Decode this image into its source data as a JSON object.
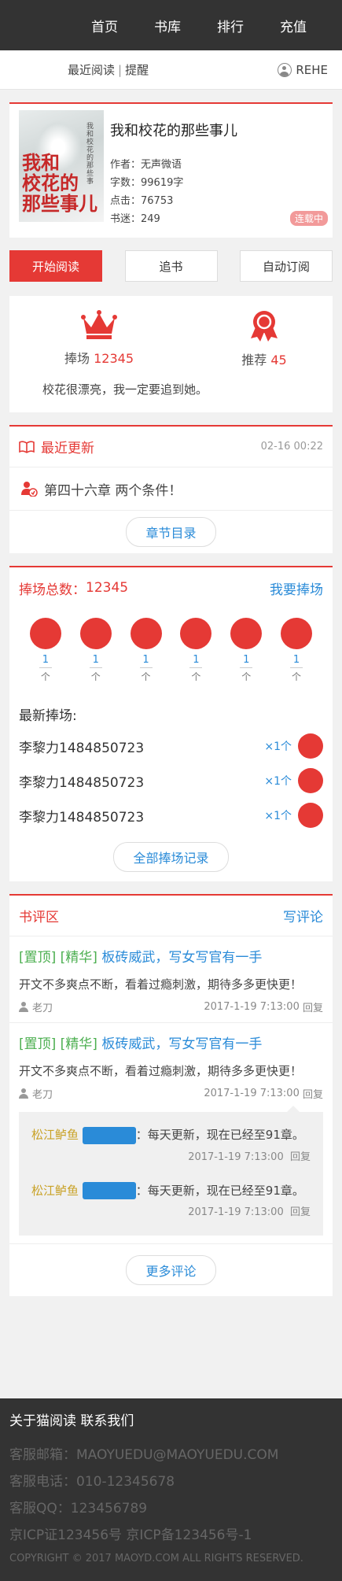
{
  "nav": {
    "items": [
      "首页",
      "书库",
      "排行",
      "充值"
    ]
  },
  "subbar": {
    "recent": "最近阅读",
    "sep": "|",
    "remind": "提醒",
    "user": "REHE"
  },
  "book": {
    "title": "我和校花的那些事儿",
    "author_label": "作者：",
    "author": "无声微语",
    "words_label": "字数：",
    "words": "99619字",
    "clicks_label": "点击：",
    "clicks": "76753",
    "fans_label": "书迷：",
    "fans": "249",
    "status": "连载中",
    "cover_text": "我和校花的那些事儿"
  },
  "actions": {
    "read": "开始阅读",
    "follow": "追书",
    "auto": "自动订阅"
  },
  "stats": {
    "support_label": "捧场",
    "support": "12345",
    "recommend_label": "推荐",
    "recommend": "45",
    "quote": "校花很漂亮，我一定要追到她。"
  },
  "updates": {
    "title": "最近更新",
    "time": "02-16 00:22",
    "chapter": "第四十六章 两个条件！",
    "toc": "章节目录"
  },
  "support": {
    "title_label": "捧场总数：",
    "total": "12345",
    "action": "我要捧场",
    "tickets": [
      {
        "n": "1",
        "u": "个"
      },
      {
        "n": "1",
        "u": "个"
      },
      {
        "n": "1",
        "u": "个"
      },
      {
        "n": "1",
        "u": "个"
      },
      {
        "n": "1",
        "u": "个"
      },
      {
        "n": "1",
        "u": "个"
      }
    ],
    "latest_title": "最新捧场:",
    "rows": [
      {
        "name": "李黎力1484850723",
        "count": "×1个"
      },
      {
        "name": "李黎力1484850723",
        "count": "×1个"
      },
      {
        "name": "李黎力1484850723",
        "count": "×1个"
      }
    ],
    "all": "全部捧场记录"
  },
  "reviews": {
    "title": "书评区",
    "write": "写评论",
    "items": [
      {
        "tags": "[置顶] [精华]",
        "title": "板砖威武，写女写官有一手",
        "content": "开文不多爽点不断，看着过瘾刺激，期待多多更快更！",
        "author": "老刀",
        "time": "2017-1-19  7:13:00",
        "reply": "回复"
      },
      {
        "tags": "[置顶] [精华]",
        "title": "板砖威武，写女写官有一手",
        "content": "开文不多爽点不断，看着过瘾刺激，期待多多更快更！",
        "author": "老刀",
        "time": "2017-1-19  7:13:00",
        "reply": "回复"
      }
    ],
    "replies": [
      {
        "who": "松江鲈鱼",
        "text": "：每天更新，现在已经至91章。",
        "time": "2017-1-19  7:13:00",
        "reply": "回复"
      },
      {
        "who": "松江鲈鱼",
        "text": "：每天更新，现在已经至91章。",
        "time": "2017-1-19  7:13:00",
        "reply": "回复"
      }
    ],
    "more": "更多评论"
  },
  "footer": {
    "links": "关于猫阅读  联系我们",
    "email": "客服邮箱：MAOYUEDU@MAOYUEDU.COM",
    "phone": "客服电话：010-12345678",
    "qq": "客服QQ：123456789",
    "icp": "京ICP证123456号 京ICP备123456号-1",
    "copyright": "COPYRIGHT © 2017 MAOYD.COM ALL RIGHTS RESERVED."
  },
  "colors": {
    "accent": "#e53935",
    "link": "#2a8bd8",
    "tag": "#4caf50",
    "dark": "#333333"
  },
  "icons": [
    "user-icon",
    "crown-icon",
    "ribbon-icon",
    "book-icon",
    "user-heart-icon",
    "person-icon"
  ]
}
